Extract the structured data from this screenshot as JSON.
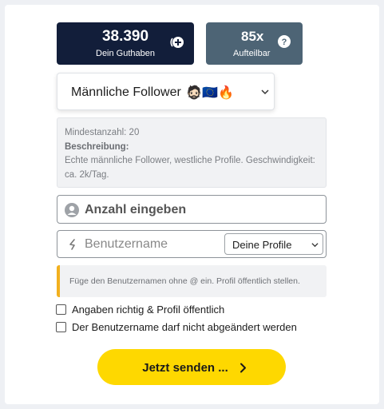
{
  "balance": {
    "amount": "38.390",
    "label": "Dein Guthaben"
  },
  "split": {
    "amount": "85x",
    "label": "Aufteilbar"
  },
  "product": {
    "selected": "Männliche Follower",
    "emoji": "🧔🏻🇪🇺🔥"
  },
  "description": {
    "min_label": "Mindestanzahl: 20",
    "desc_label": "Beschreibung:",
    "desc_text": "Echte männliche Follower, westliche Profile. Geschwindigkeit: ca. 2k/Tag."
  },
  "quantity": {
    "placeholder": "Anzahl eingeben"
  },
  "username": {
    "placeholder": "Benutzername",
    "profile_select": "Deine Profile"
  },
  "hint": {
    "text": "Füge den Benutzernamen ohne @ ein. Profil öffentlich stellen."
  },
  "checkboxes": [
    {
      "label": "Angaben richtig & Profil öffentlich"
    },
    {
      "label": "Der Benutzername darf nicht abgeändert werden"
    }
  ],
  "submit": {
    "label": "Jetzt senden ..."
  },
  "colors": {
    "balance_bg": "#121e3a",
    "split_bg": "#4d6475",
    "accent": "#fed800",
    "hint_border": "#f2b01e"
  },
  "icons": [
    "add-icon",
    "help-icon",
    "chevron-down-icon",
    "user-icon",
    "at-icon",
    "chevron-right-icon"
  ]
}
